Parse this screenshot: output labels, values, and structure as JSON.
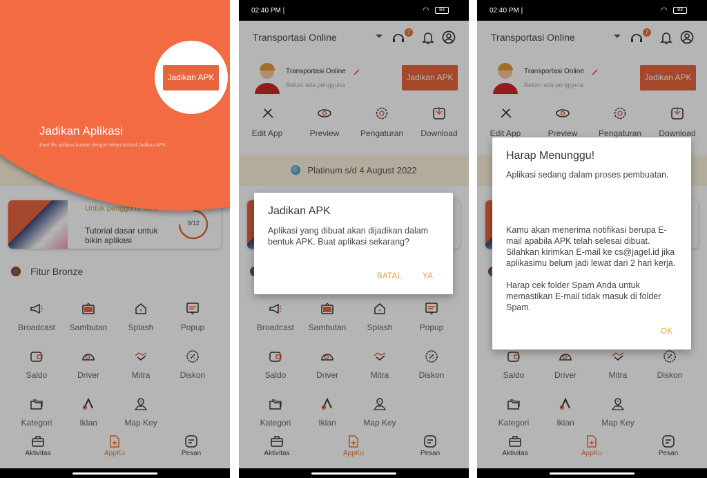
{
  "status": {
    "time": "02:40 PM |",
    "battery": "83"
  },
  "app": {
    "selector": "Transportasi Online",
    "support_badge": "7",
    "profile_name": "Transportasi Online",
    "profile_sub": "Belum ada pengguna",
    "apk_button": "Jadikan APK",
    "actions": [
      {
        "label": "Edit App",
        "icon": "pencil-ruler-icon"
      },
      {
        "label": "Preview",
        "icon": "eye-icon"
      },
      {
        "label": "Pengaturan",
        "icon": "gear-icon"
      },
      {
        "label": "Download",
        "icon": "download-icon"
      }
    ],
    "plan": "Platinum s/d 4 August 2022",
    "tutorial": {
      "tag": "Untuk pengguna baru",
      "title": "Tutorial dasar untuk bikin aplikasi",
      "progress": "9/12",
      "progress_fraction": 0.75
    },
    "section": "Fitur Bronze",
    "features": [
      {
        "label": "Broadcast",
        "icon": "megaphone-icon"
      },
      {
        "label": "Sambutan",
        "icon": "welcome-sign-icon"
      },
      {
        "label": "Splash",
        "icon": "home-icon"
      },
      {
        "label": "Popup",
        "icon": "popup-icon"
      },
      {
        "label": "Saldo",
        "icon": "wallet-icon"
      },
      {
        "label": "Driver",
        "icon": "helmet-icon"
      },
      {
        "label": "Mitra",
        "icon": "handshake-icon"
      },
      {
        "label": "Diskon",
        "icon": "discount-icon"
      },
      {
        "label": "Kategori",
        "icon": "folders-icon"
      },
      {
        "label": "Iklan",
        "icon": "ads-icon"
      },
      {
        "label": "Map Key",
        "icon": "map-pin-icon"
      }
    ],
    "nav": [
      {
        "label": "Aktivitas",
        "icon": "briefcase-icon",
        "active": false
      },
      {
        "label": "AppKu",
        "icon": "app-file-icon",
        "active": true
      },
      {
        "label": "Pesan",
        "icon": "message-icon",
        "active": false
      }
    ]
  },
  "onboarding": {
    "title": "Jadikan Aplikasi",
    "subtitle": "Buat file aplikasi buatan dengan tekan tombol Jadikan APK",
    "button": "Jadikan APK"
  },
  "confirm_dialog": {
    "title": "Jadikan APK",
    "message": "Aplikasi yang dibuat akan dijadikan dalam bentuk APK. Buat aplikasi sekarang?",
    "cancel": "BATAL",
    "ok": "YA"
  },
  "wait_dialog": {
    "title": "Harap Menunggu!",
    "paragraphs": [
      "Aplikasi sedang dalam proses pembuatan.",
      "Kamu akan menerima notifikasi berupa E-mail apabila APK telah selesai dibuat. Silahkan kirimkan E-mail ke cs@jagel.id jika aplikasimu belum jadi lewat dari 2 hari kerja.",
      "Harap cek folder Spam Anda untuk memastikan E-mail tidak masuk di folder Spam."
    ],
    "ok": "OK"
  },
  "colors": {
    "accent": "#f26b43",
    "button": "#e8643c",
    "dialog_action": "#e6a030",
    "nav_active": "#e8743f"
  }
}
